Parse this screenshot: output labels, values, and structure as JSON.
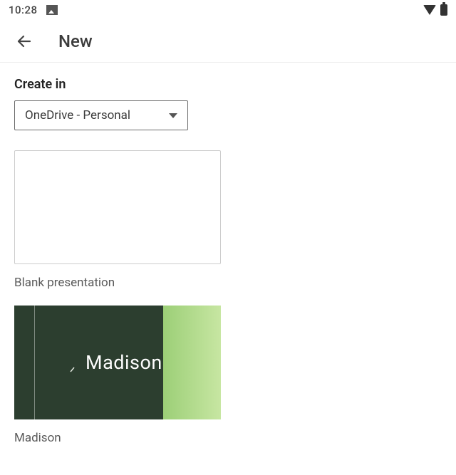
{
  "status": {
    "time": "10:28"
  },
  "header": {
    "title": "New"
  },
  "create_in": {
    "label": "Create in",
    "selected": "OneDrive - Personal"
  },
  "templates": [
    {
      "label": "Blank presentation",
      "style": "blank"
    },
    {
      "label": "Madison",
      "style": "madison",
      "thumb_text": "Madison"
    }
  ]
}
